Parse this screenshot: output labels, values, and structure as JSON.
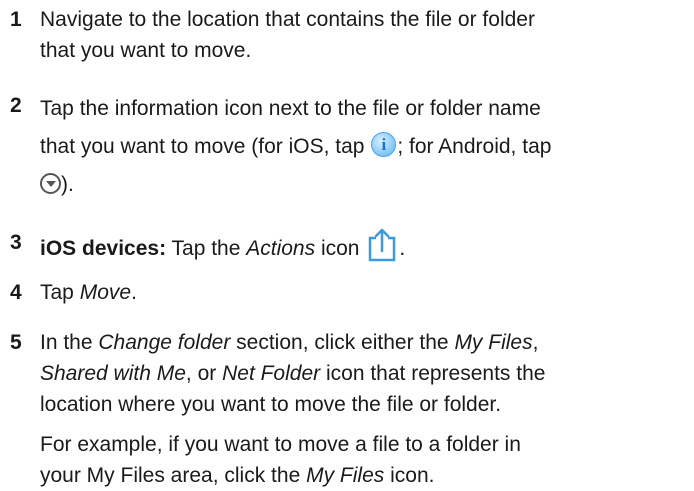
{
  "steps": [
    {
      "number": "1",
      "lines": [
        "Navigate to the location that contains the file or folder",
        "that you want to move."
      ]
    },
    {
      "number": "2",
      "line1": "Tap the information icon next to the file or folder name",
      "line2_a": "that you want to move (for iOS, tap ",
      "line2_b": "; for Android, tap",
      "line3_b": ")."
    },
    {
      "number": "3",
      "bold": "iOS devices:",
      "a": " Tap the ",
      "em": "Actions",
      "b": " icon ",
      "c": "."
    },
    {
      "number": "4",
      "a": "Tap ",
      "em": "Move",
      "b": "."
    },
    {
      "number": "5",
      "l1_a": "In the ",
      "l1_em1": "Change folder",
      "l1_b": " section, click either the ",
      "l1_em2": "My Files",
      "l1_c": ",",
      "l2_em1": "Shared with Me",
      "l2_a": ", or ",
      "l2_em2": "Net Folder",
      "l2_b": " icon that represents the",
      "l3": "location where you want to move the file or folder.",
      "p2_l1": "For example, if you want to move a file to a folder in",
      "p2_l2_a": "your My Files area, click the ",
      "p2_l2_em": "My Files",
      "p2_l2_b": " icon."
    }
  ],
  "icons": {
    "info_glyph": "i"
  },
  "colors": {
    "info_icon": "#5cb4f0",
    "actions_icon": "#3a9be0"
  }
}
